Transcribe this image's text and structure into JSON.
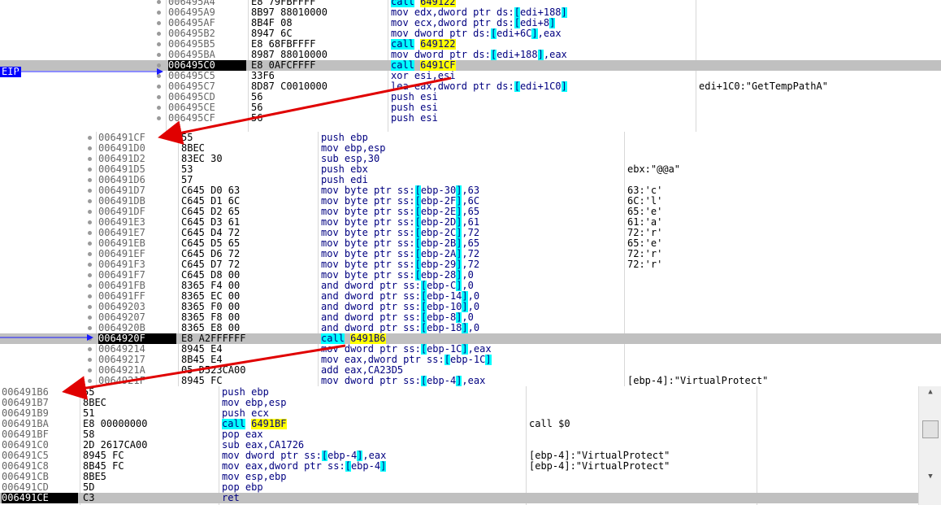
{
  "colors": {
    "call_highlight": "#00ffff",
    "target_highlight": "#ffff00",
    "selected_row": "#c0c0c0",
    "eip_tag": "#0000ff",
    "arrow": "#ff0000"
  },
  "eip_label": "EIP",
  "panel1": {
    "rows": [
      {
        "addr": "006495A4",
        "bytes": "E8 79FBFFFF",
        "instr": "call 649122",
        "comment": ""
      },
      {
        "addr": "006495A9",
        "bytes": "8B97 88010000",
        "instr": "mov edx,dword ptr ds:[edi+188]",
        "comment": ""
      },
      {
        "addr": "006495AF",
        "bytes": "8B4F 08",
        "instr": "mov ecx,dword ptr ds:[edi+8]",
        "comment": ""
      },
      {
        "addr": "006495B2",
        "bytes": "8947 6C",
        "instr": "mov dword ptr ds:[edi+6C],eax",
        "comment": ""
      },
      {
        "addr": "006495B5",
        "bytes": "E8 68FBFFFF",
        "instr": "call 649122",
        "comment": ""
      },
      {
        "addr": "006495BA",
        "bytes": "8987 88010000",
        "instr": "mov dword ptr ds:[edi+188],eax",
        "comment": ""
      },
      {
        "addr": "006495C0",
        "bytes": "E8 0AFCFFFF",
        "instr": "call 6491CF",
        "comment": ""
      },
      {
        "addr": "006495C5",
        "bytes": "33F6",
        "instr": "xor esi,esi",
        "comment": ""
      },
      {
        "addr": "006495C7",
        "bytes": "8D87 C0010000",
        "instr": "lea eax,dword ptr ds:[edi+1C0]",
        "comment": "edi+1C0:\"GetTempPathA\""
      },
      {
        "addr": "006495CD",
        "bytes": "56",
        "instr": "push esi",
        "comment": ""
      },
      {
        "addr": "006495CE",
        "bytes": "56",
        "instr": "push esi",
        "comment": ""
      },
      {
        "addr": "006495CF",
        "bytes": "56",
        "instr": "push esi",
        "comment": ""
      }
    ]
  },
  "panel2": {
    "rows": [
      {
        "addr": "006491CF",
        "bytes": "55",
        "instr": "push ebp",
        "comment": ""
      },
      {
        "addr": "006491D0",
        "bytes": "8BEC",
        "instr": "mov ebp,esp",
        "comment": ""
      },
      {
        "addr": "006491D2",
        "bytes": "83EC 30",
        "instr": "sub esp,30",
        "comment": ""
      },
      {
        "addr": "006491D5",
        "bytes": "53",
        "instr": "push ebx",
        "comment": "ebx:\"@@a\""
      },
      {
        "addr": "006491D6",
        "bytes": "57",
        "instr": "push edi",
        "comment": ""
      },
      {
        "addr": "006491D7",
        "bytes": "C645 D0 63",
        "instr": "mov byte ptr ss:[ebp-30],63",
        "comment": "63:'c'"
      },
      {
        "addr": "006491DB",
        "bytes": "C645 D1 6C",
        "instr": "mov byte ptr ss:[ebp-2F],6C",
        "comment": "6C:'l'"
      },
      {
        "addr": "006491DF",
        "bytes": "C645 D2 65",
        "instr": "mov byte ptr ss:[ebp-2E],65",
        "comment": "65:'e'"
      },
      {
        "addr": "006491E3",
        "bytes": "C645 D3 61",
        "instr": "mov byte ptr ss:[ebp-2D],61",
        "comment": "61:'a'"
      },
      {
        "addr": "006491E7",
        "bytes": "C645 D4 72",
        "instr": "mov byte ptr ss:[ebp-2C],72",
        "comment": "72:'r'"
      },
      {
        "addr": "006491EB",
        "bytes": "C645 D5 65",
        "instr": "mov byte ptr ss:[ebp-2B],65",
        "comment": "65:'e'"
      },
      {
        "addr": "006491EF",
        "bytes": "C645 D6 72",
        "instr": "mov byte ptr ss:[ebp-2A],72",
        "comment": "72:'r'"
      },
      {
        "addr": "006491F3",
        "bytes": "C645 D7 72",
        "instr": "mov byte ptr ss:[ebp-29],72",
        "comment": "72:'r'"
      },
      {
        "addr": "006491F7",
        "bytes": "C645 D8 00",
        "instr": "mov byte ptr ss:[ebp-28],0",
        "comment": ""
      },
      {
        "addr": "006491FB",
        "bytes": "8365 F4 00",
        "instr": "and dword ptr ss:[ebp-C],0",
        "comment": ""
      },
      {
        "addr": "006491FF",
        "bytes": "8365 EC 00",
        "instr": "and dword ptr ss:[ebp-14],0",
        "comment": ""
      },
      {
        "addr": "00649203",
        "bytes": "8365 F0 00",
        "instr": "and dword ptr ss:[ebp-10],0",
        "comment": ""
      },
      {
        "addr": "00649207",
        "bytes": "8365 F8 00",
        "instr": "and dword ptr ss:[ebp-8],0",
        "comment": ""
      },
      {
        "addr": "0064920B",
        "bytes": "8365 E8 00",
        "instr": "and dword ptr ss:[ebp-18],0",
        "comment": ""
      },
      {
        "addr": "0064920F",
        "bytes": "E8 A2FFFFFF",
        "instr": "call 6491B6",
        "comment": ""
      },
      {
        "addr": "00649214",
        "bytes": "8945 E4",
        "instr": "mov dword ptr ss:[ebp-1C],eax",
        "comment": ""
      },
      {
        "addr": "00649217",
        "bytes": "8B45 E4",
        "instr": "mov eax,dword ptr ss:[ebp-1C]",
        "comment": ""
      },
      {
        "addr": "0064921A",
        "bytes": "05 D523CA00",
        "instr": "add eax,CA23D5",
        "comment": ""
      },
      {
        "addr": "0064921F",
        "bytes": "8945 FC",
        "instr": "mov dword ptr ss:[ebp-4],eax",
        "comment": "[ebp-4]:\"VirtualProtect\""
      }
    ]
  },
  "panel3": {
    "rows": [
      {
        "addr": "006491B6",
        "bytes": "55",
        "instr": "push ebp",
        "comment": ""
      },
      {
        "addr": "006491B7",
        "bytes": "8BEC",
        "instr": "mov ebp,esp",
        "comment": ""
      },
      {
        "addr": "006491B9",
        "bytes": "51",
        "instr": "push ecx",
        "comment": ""
      },
      {
        "addr": "006491BA",
        "bytes": "E8 00000000",
        "instr": "call 6491BF",
        "comment": "call $0"
      },
      {
        "addr": "006491BF",
        "bytes": "58",
        "instr": "pop eax",
        "comment": ""
      },
      {
        "addr": "006491C0",
        "bytes": "2D 2617CA00",
        "instr": "sub eax,CA1726",
        "comment": ""
      },
      {
        "addr": "006491C5",
        "bytes": "8945 FC",
        "instr": "mov dword ptr ss:[ebp-4],eax",
        "comment": "[ebp-4]:\"VirtualProtect\""
      },
      {
        "addr": "006491C8",
        "bytes": "8B45 FC",
        "instr": "mov eax,dword ptr ss:[ebp-4]",
        "comment": "[ebp-4]:\"VirtualProtect\""
      },
      {
        "addr": "006491CB",
        "bytes": "8BE5",
        "instr": "mov esp,ebp",
        "comment": ""
      },
      {
        "addr": "006491CD",
        "bytes": "5D",
        "instr": "pop ebp",
        "comment": ""
      },
      {
        "addr": "006491CE",
        "bytes": "C3",
        "instr": "ret",
        "comment": ""
      }
    ]
  }
}
